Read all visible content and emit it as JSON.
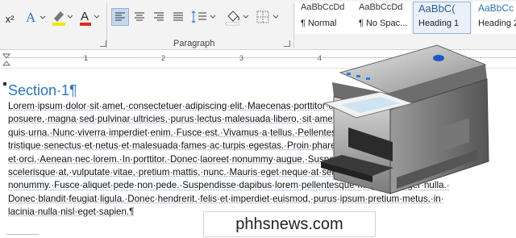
{
  "ribbon": {
    "paragraph_label": "Paragraph",
    "superscript": "x²",
    "styles": [
      {
        "preview": "AaBbCcDd",
        "name": "¶ Normal"
      },
      {
        "preview": "AaBbCcDd",
        "name": "¶ No Spac..."
      },
      {
        "preview": "AaBbC(",
        "name": "Heading 1"
      },
      {
        "preview": "AaBbCc",
        "name": "Heading 2"
      }
    ]
  },
  "ruler": {
    "numbers": [
      "1",
      "2",
      "3",
      "4"
    ]
  },
  "document": {
    "heading": "Section·1¶",
    "lines": [
      "Lorem·ipsum·dolor·sit·amet,·consectetuer·adipiscing·elit.·Maecenas·porttitor·congue·massa.·Fusce·",
      "posuere,·magna·sed·pulvinar·ultricies,·purus·lectus·malesuada·libero,·sit·amet·commodo·magna·eros·",
      "quis·urna.·Nunc·viverra·imperdiet·enim.·Fusce·est.·Vivamus·a·tellus.·Pellentesque·habitant·morbi·",
      "tristique·senectus·et·netus·et·malesuada·fames·ac·turpis·egestas.·Proin·pharetra·nonummy·pede.·Mauris·",
      "et·orci.·Aenean·nec·lorem.·In·porttitor.·Donec·laoreet·nonummy·augue.·Suspendisse·dui·purus,·",
      "scelerisque·at,·vulputate·vitae,·pretium·mattis,·nunc.·Mauris·eget·neque·at·sem·venenatis·eleifend.·Ut·",
      "nonummy.·Fusce·aliquet·pede·non·pede.·Suspendisse·dapibus·lorem·pellentesque·magna.·Integer·nulla.·",
      "Donec·blandit·feugiat·ligula.·Donec·hendrerit,·felis·et·imperdiet·euismod,·purus·ipsum·pretium·metus,·in·",
      "lacinia·nulla·nisl·eget·sapien.¶"
    ]
  },
  "watermark": "phhsnews.com",
  "colors": {
    "heading": "#2e74b5",
    "highlight": "#f5e50a",
    "font_color": "#e02b20"
  }
}
